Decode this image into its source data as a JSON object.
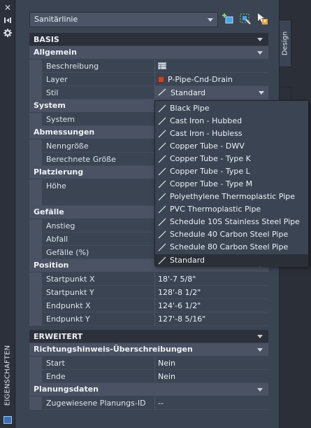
{
  "palette": {
    "title": "EIGENSCHAFTEN",
    "tab": "Design"
  },
  "object_selector": "Sanitärlinie",
  "sections": {
    "basis": "BASIS",
    "erweitert": "ERWEITERT"
  },
  "groups": {
    "allgemein": "Allgemein",
    "system": "System",
    "abmessungen": "Abmessungen",
    "platzierung": "Platzierung",
    "gefaelle": "Gefälle",
    "position": "Position",
    "richtung": "Richtungshinweis-Überschreibungen",
    "planungsdaten": "Planungsdaten"
  },
  "props": {
    "beschreibung": {
      "label": "Beschreibung",
      "value": ""
    },
    "layer": {
      "label": "Layer",
      "value": "P-Pipe-Cnd-Drain",
      "swatch": "#c0492c"
    },
    "stil": {
      "label": "Stil",
      "value": "Standard"
    },
    "system": {
      "label": "System",
      "value": ""
    },
    "nenngroesse": {
      "label": "Nenngröße",
      "value": ""
    },
    "berechnete": {
      "label": "Berechnete Größe",
      "value": ""
    },
    "hoehe": {
      "label": "Höhe",
      "value": ""
    },
    "anstieg": {
      "label": "Anstieg",
      "value": ""
    },
    "abfall": {
      "label": "Abfall",
      "value": ""
    },
    "gefaelle_pct": {
      "label": "Gefälle (%)",
      "value": ""
    },
    "startx": {
      "label": "Startpunkt X",
      "value": "18'-7 5/8\""
    },
    "starty": {
      "label": "Startpunkt Y",
      "value": "128'-8 1/2\""
    },
    "endx": {
      "label": "Endpunkt X",
      "value": "124'-6 1/2\""
    },
    "endy": {
      "label": "Endpunkt Y",
      "value": "127'-8 5/16\""
    },
    "start": {
      "label": "Start",
      "value": "Nein"
    },
    "ende": {
      "label": "Ende",
      "value": "Nein"
    },
    "planungs_id": {
      "label": "Zugewiesene Planungs-ID",
      "value": "--"
    }
  },
  "style_options": [
    "Black Pipe",
    "Cast Iron - Hubbed",
    "Cast Iron - Hubless",
    "Copper Tube - DWV",
    "Copper Tube - Type K",
    "Copper Tube - Type L",
    "Copper Tube - Type M",
    "Polyethylene Thermoplastic Pipe",
    "PVC Thermoplastic Pipe",
    "Schedule 10S Stainless Steel Pipe",
    "Schedule 40 Carbon Steel Pipe",
    "Schedule 80 Carbon Steel Pipe",
    "Standard"
  ],
  "icons": {
    "close": "close-icon",
    "pin": "auto-hide-icon",
    "settings": "settings-icon",
    "add_selected": "add-selected-icon",
    "quick_select": "quick-select-icon",
    "select_objects": "select-objects-icon",
    "style_line": "style-line-icon",
    "table": "table-icon",
    "palette": "palette-icon"
  }
}
